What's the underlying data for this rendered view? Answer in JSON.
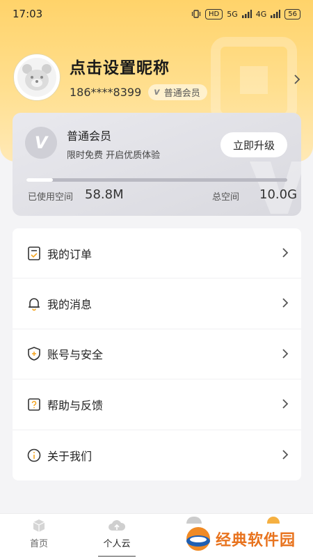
{
  "status_bar": {
    "time": "17:03",
    "network_a": "5G",
    "network_b": "4G",
    "hd_label": "HD",
    "battery": "56"
  },
  "profile": {
    "nickname": "点击设置昵称",
    "phone": "186****8399",
    "member_badge": "普通会员",
    "member_badge_icon_letter": "v"
  },
  "member_card": {
    "logo_letter": "V",
    "title": "普通会员",
    "subtitle": "限时免费  开启优质体验",
    "upgrade_button": "立即升级",
    "usage_progress": 0.01,
    "used_label": "已使用空间",
    "used_value": "58.8M",
    "total_label": "总空间",
    "total_value": "10.0G"
  },
  "menu": {
    "items": [
      {
        "label": "我的订单",
        "icon": "order-icon"
      },
      {
        "label": "我的消息",
        "icon": "bell-icon"
      },
      {
        "label": "账号与安全",
        "icon": "shield-icon"
      },
      {
        "label": "帮助与反馈",
        "icon": "help-icon"
      },
      {
        "label": "关于我们",
        "icon": "info-icon"
      }
    ]
  },
  "bottom_nav": {
    "items": [
      {
        "label": "首页",
        "icon": "home-cube-icon"
      },
      {
        "label": "个人云",
        "icon": "cloud-upload-icon"
      }
    ]
  },
  "watermark": {
    "text": "经典软件园"
  },
  "colors": {
    "hero_yellow": "#ffd36a",
    "card_gray": "#dcdce2",
    "watermark_orange": "#e8731e"
  }
}
